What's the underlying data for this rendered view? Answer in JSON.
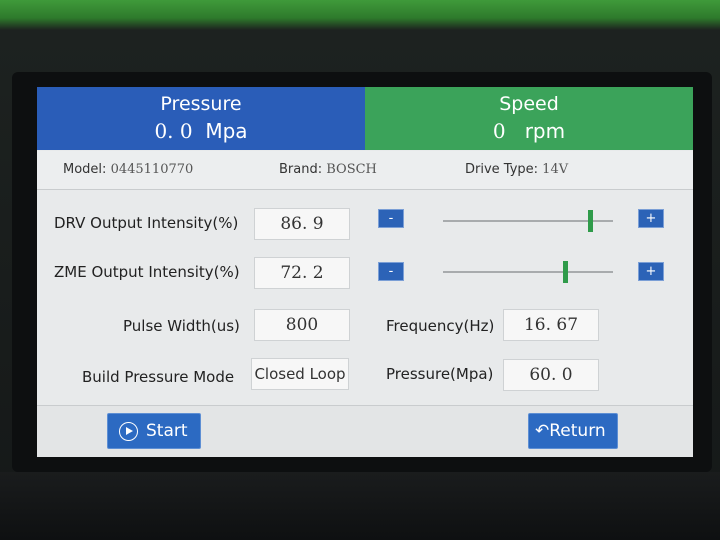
{
  "header": {
    "pressure": {
      "title": "Pressure",
      "value": "0. 0",
      "unit": "Mpa"
    },
    "speed": {
      "title": "Speed",
      "value": "0",
      "unit": "rpm"
    }
  },
  "info": {
    "model_label": "Model:",
    "model": "0445110770",
    "brand_label": "Brand:",
    "brand": "BOSCH",
    "drive_label": "Drive Type:",
    "drive": "14V"
  },
  "drv": {
    "label": "DRV Output Intensity(%)",
    "value": "86. 9",
    "minus": "-",
    "plus": "+",
    "slider_level": 0.87
  },
  "zme": {
    "label": "ZME Output Intensity(%)",
    "value": "72. 2",
    "minus": "-",
    "plus": "+",
    "slider_level": 0.72
  },
  "pulse": {
    "label": "Pulse Width(us)",
    "value": "800"
  },
  "frequency": {
    "label": "Frequency(Hz)",
    "value": "16. 67"
  },
  "mode": {
    "label": "Build Pressure Mode",
    "value": "Closed Loop"
  },
  "target_pressure": {
    "label": "Pressure(Mpa)",
    "value": "60. 0"
  },
  "buttons": {
    "start": "Start",
    "return_label": "↶Return"
  },
  "colors": {
    "pressure_bg": "#2a5db8",
    "speed_bg": "#3ba35a",
    "button": "#2c6ac2",
    "slider_thumb": "#2f9b4a"
  }
}
